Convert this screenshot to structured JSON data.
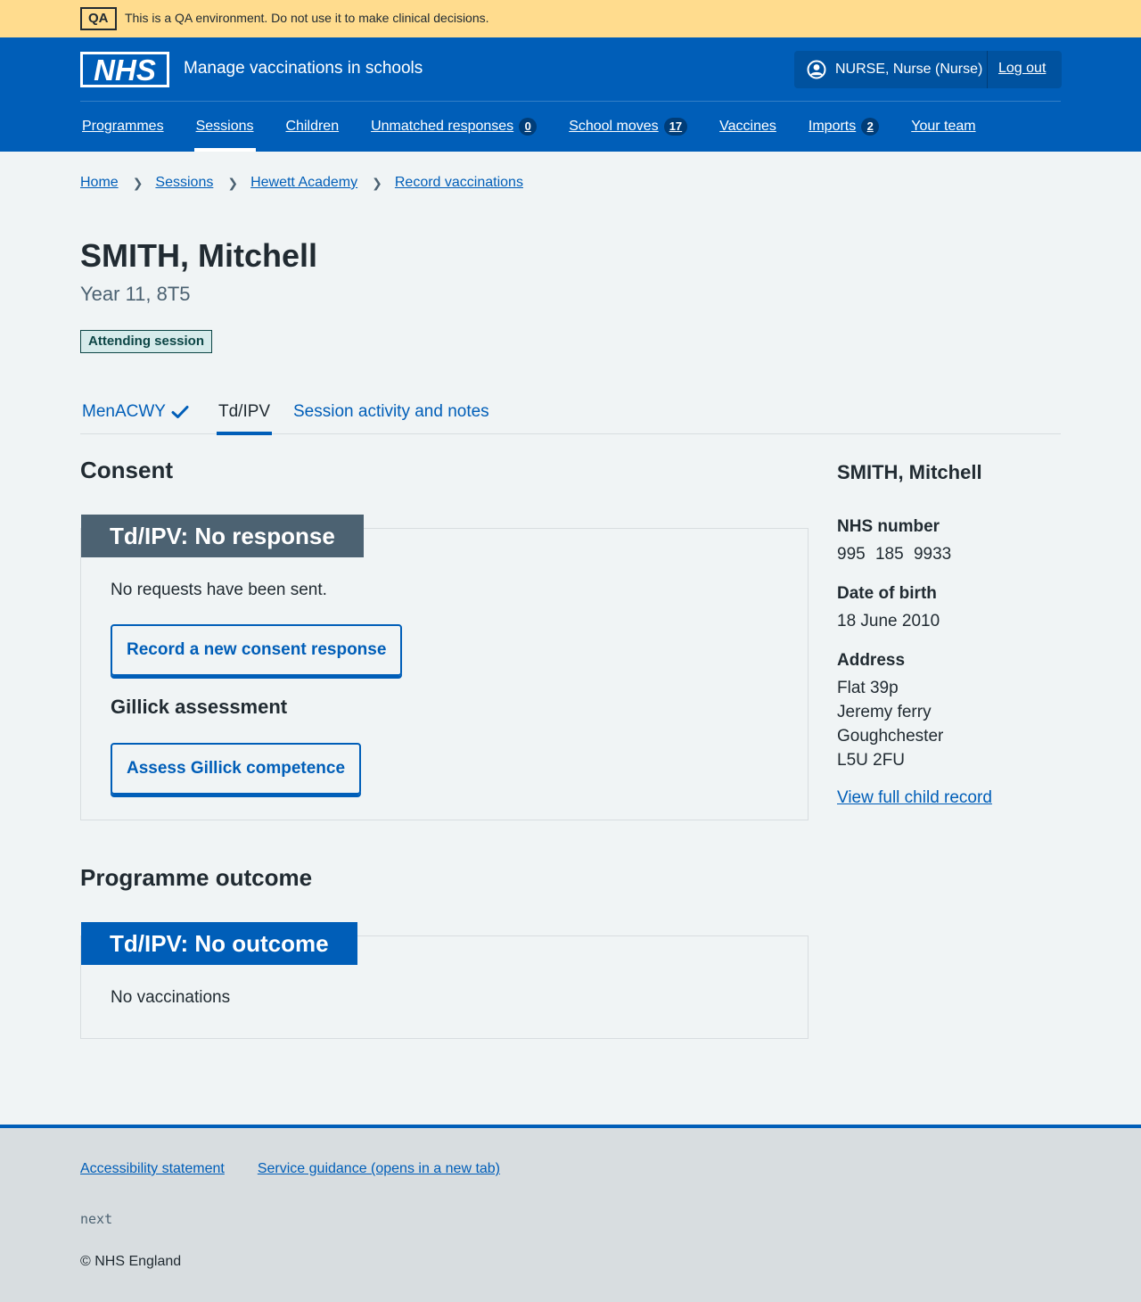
{
  "qa_banner": {
    "tag": "QA",
    "text": "This is a QA environment. Do not use it to make clinical decisions."
  },
  "header": {
    "logo_text": "NHS",
    "service_name": "Manage vaccinations in schools",
    "account_user": "NURSE, Nurse (Nurse)",
    "logout_label": "Log out",
    "account_icon": "user-circle-icon"
  },
  "nav": {
    "programmes": "Programmes",
    "sessions": "Sessions",
    "children": "Children",
    "unmatched": "Unmatched responses",
    "unmatched_count": "0",
    "school_moves": "School moves",
    "school_moves_count": "17",
    "vaccines": "Vaccines",
    "imports": "Imports",
    "imports_count": "2",
    "your_team": "Your team",
    "active": "Sessions"
  },
  "breadcrumb": [
    "Home",
    "Sessions",
    "Hewett Academy",
    "Record vaccinations"
  ],
  "patient": {
    "name": "SMITH, Mitchell",
    "caption": "Year 11, 8T5",
    "status": "Attending session"
  },
  "tabs": {
    "menacwy": "MenACWY",
    "tdipv": "Td/IPV",
    "activity": "Session activity and notes",
    "active": "Td/IPV"
  },
  "consent": {
    "heading": "Consent",
    "card_title": "Td/IPV: No response",
    "message": "No requests have been sent.",
    "record_button": "Record a new consent response",
    "gillick_heading": "Gillick assessment",
    "gillick_button": "Assess Gillick competence"
  },
  "outcome": {
    "heading": "Programme outcome",
    "card_title": "Td/IPV: No outcome",
    "message": "No vaccinations"
  },
  "sidebar": {
    "name": "SMITH, Mitchell",
    "nhs_label": "NHS number",
    "nhs_value": "995 185 9933",
    "dob_label": "Date of birth",
    "dob_value": "18 June 2010",
    "address_label": "Address",
    "address": [
      "Flat 39p",
      "Jeremy ferry",
      "Goughchester",
      "L5U 2FU"
    ],
    "full_record_link": "View full child record"
  },
  "footer": {
    "accessibility": "Accessibility statement",
    "guidance": "Service guidance (opens in a new tab)",
    "version": "next",
    "copyright": "© NHS England"
  },
  "colors": {
    "nhs_blue": "#005eb8",
    "qa_banner": "#ffdc8e",
    "text": "#212b32",
    "secondary_text": "#4c6272",
    "background": "#f0f4f5",
    "tag_bg": "#d6ebeb",
    "footer_bg": "#d8dde0"
  }
}
